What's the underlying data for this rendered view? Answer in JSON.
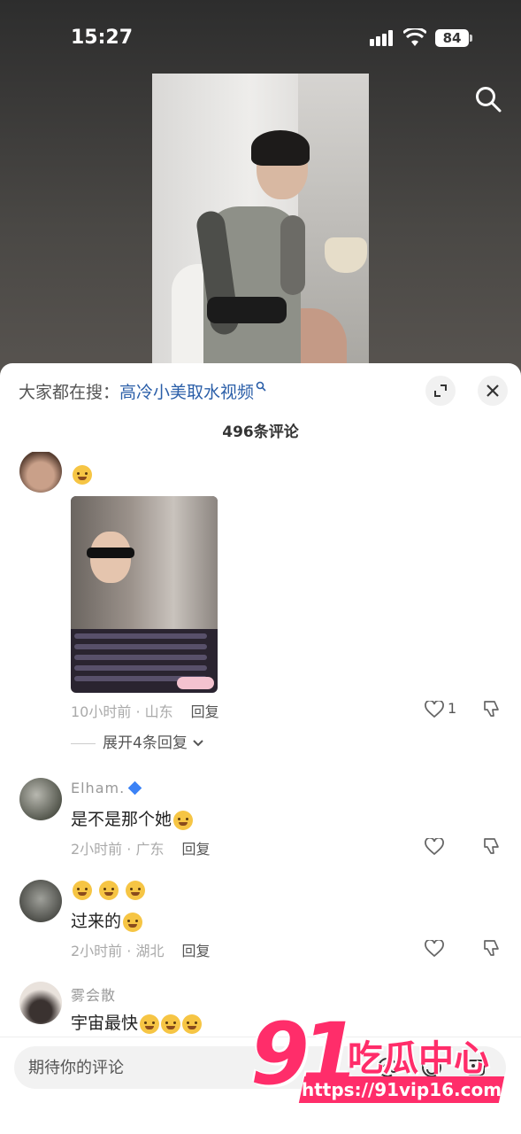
{
  "status_bar": {
    "time": "15:27",
    "battery": "84"
  },
  "sheet": {
    "search_prefix": "大家都在搜：",
    "search_keyword": "高冷小美取水视频",
    "comment_count": "496条评论"
  },
  "comments": [
    {
      "meta": "10小时前 · 山东",
      "reply_label": "回复",
      "likes": "1",
      "expand_replies": "展开4条回复"
    },
    {
      "username": "Elham.",
      "text": "是不是那个她",
      "meta": "2小时前 · 广东",
      "reply_label": "回复"
    },
    {
      "text": "过来的",
      "meta": "2小时前 · 湖北",
      "reply_label": "回复"
    },
    {
      "username": "雾会散",
      "text": "宇宙最快"
    }
  ],
  "input": {
    "placeholder": "期待你的评论"
  },
  "watermark": {
    "number": "91",
    "text": "吃瓜中心",
    "url": "https://91vip16.com"
  },
  "icons": [
    "search-icon",
    "expand-icon",
    "close-icon",
    "heart-icon",
    "thumb-down-icon",
    "chevron-down-icon",
    "at-icon",
    "emoji-icon",
    "image-icon",
    "wifi-icon",
    "signal-icon"
  ]
}
